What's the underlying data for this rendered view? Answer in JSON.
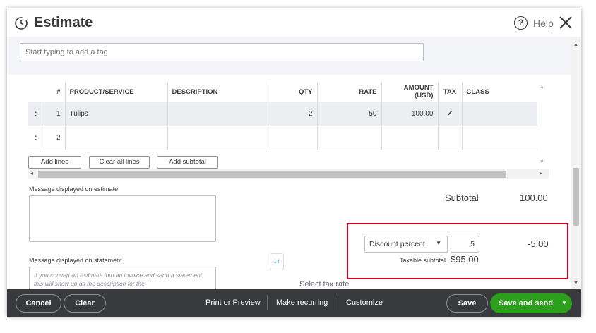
{
  "header": {
    "title": "Estimate",
    "help_label": "Help"
  },
  "tags": {
    "placeholder": "Start typing to add a tag"
  },
  "table": {
    "columns": [
      "#",
      "PRODUCT/SERVICE",
      "DESCRIPTION",
      "QTY",
      "RATE",
      "AMOUNT (USD)",
      "TAX",
      "CLASS"
    ],
    "rows": [
      {
        "num": "1",
        "product": "Tulips",
        "description": "",
        "qty": "2",
        "rate": "50",
        "amount": "100.00",
        "tax": "✔",
        "class": ""
      },
      {
        "num": "2",
        "product": "",
        "description": "",
        "qty": "",
        "rate": "",
        "amount": "",
        "tax": "",
        "class": ""
      }
    ]
  },
  "line_buttons": {
    "add_lines": "Add lines",
    "clear_all_lines": "Clear all lines",
    "add_subtotal": "Add subtotal"
  },
  "messages": {
    "estimate_label": "Message displayed on estimate",
    "statement_label": "Message displayed on statement",
    "statement_placeholder": "If you convert an estimate into an invoice and send a statement, this will show up as the description for the"
  },
  "totals": {
    "subtotal_label": "Subtotal",
    "subtotal_value": "100.00",
    "discount_type": "Discount percent",
    "discount_value": "5",
    "discount_amount": "-5.00",
    "taxable_subtotal_label": "Taxable subtotal",
    "taxable_subtotal_value": "$95.00",
    "select_tax_rate": "Select tax rate"
  },
  "footer": {
    "cancel": "Cancel",
    "clear": "Clear",
    "print_preview": "Print or Preview",
    "make_recurring": "Make recurring",
    "customize": "Customize",
    "save": "Save",
    "save_and_send": "Save and send"
  },
  "colors": {
    "accent_green": "#2ca01c",
    "footer_bg": "#393a3d",
    "highlight_red": "#d0021b"
  }
}
